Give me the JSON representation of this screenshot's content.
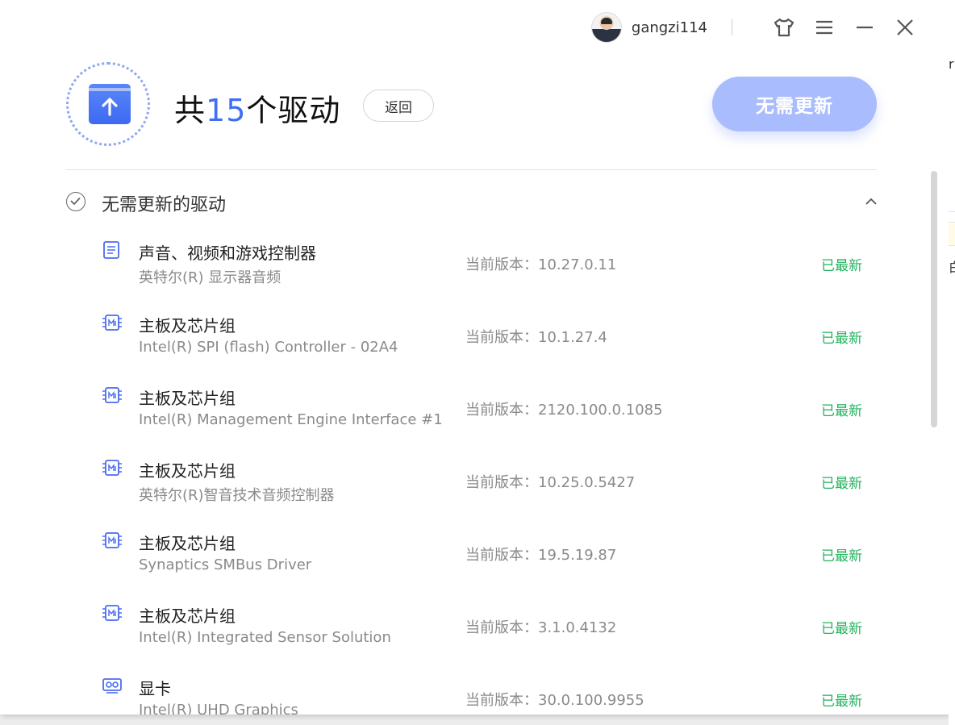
{
  "topbar": {
    "username": "gangzi114",
    "icons": [
      "avatar",
      "skin-icon",
      "menu-icon",
      "minimize-icon",
      "close-icon"
    ]
  },
  "header": {
    "title_prefix": "共",
    "count": "15",
    "title_suffix": "个驱动",
    "back_label": "返回",
    "primary_label": "无需更新",
    "accent_color": "#3f6ff2",
    "button_color": "#a9bcfd"
  },
  "section": {
    "title": "无需更新的驱动",
    "collapsed": false
  },
  "version_prefix": "当前版本：",
  "drivers": [
    {
      "category": "声音、视频和游戏控制器",
      "name": "英特尔(R) 显示器音频",
      "version": "10.27.0.11",
      "status": "已最新",
      "icon": "audio-controller-icon"
    },
    {
      "category": "主板及芯片组",
      "name": "Intel(R) SPI (flash) Controller - 02A4",
      "version": "10.1.27.4",
      "status": "已最新",
      "icon": "chipset-icon"
    },
    {
      "category": "主板及芯片组",
      "name": "Intel(R) Management Engine Interface #1",
      "version": "2120.100.0.1085",
      "status": "已最新",
      "icon": "chipset-icon"
    },
    {
      "category": "主板及芯片组",
      "name": "英特尔(R)智音技术音频控制器",
      "version": "10.25.0.5427",
      "status": "已最新",
      "icon": "chipset-icon"
    },
    {
      "category": "主板及芯片组",
      "name": "Synaptics SMBus Driver",
      "version": "19.5.19.87",
      "status": "已最新",
      "icon": "chipset-icon"
    },
    {
      "category": "主板及芯片组",
      "name": "Intel(R) Integrated Sensor Solution",
      "version": "3.1.0.4132",
      "status": "已最新",
      "icon": "chipset-icon"
    },
    {
      "category": "显卡",
      "name": "Intel(R) UHD Graphics",
      "version": "30.0.100.9955",
      "status": "已最新",
      "icon": "graphics-card-icon"
    }
  ],
  "status_color": "#22b35e",
  "background_window": {
    "glyph_top": "r",
    "glyph_bottom": "白"
  }
}
